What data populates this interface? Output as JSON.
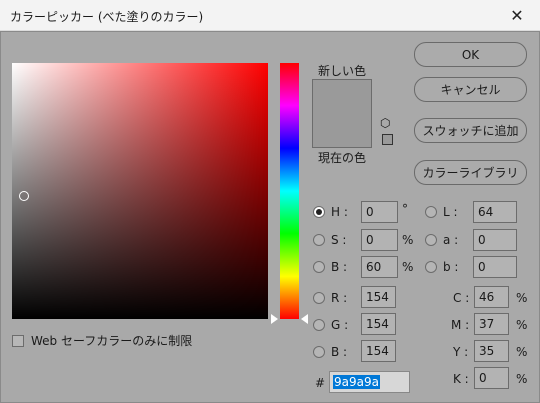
{
  "window": {
    "title": "カラーピッカー (べた塗りのカラー)"
  },
  "swatch": {
    "new_label": "新しい色",
    "current_label": "現在の色",
    "new_color": "#9a9a9a",
    "current_color": "#9a9a9a"
  },
  "buttons": {
    "ok": "OK",
    "cancel": "キャンセル",
    "add_swatch": "スウォッチに追加",
    "libraries": "カラーライブラリ"
  },
  "web_only": {
    "label": "Web セーフカラーのみに制限",
    "checked": false
  },
  "hsb": {
    "h": {
      "label": "H :",
      "value": "0",
      "unit": "°",
      "selected": true
    },
    "s": {
      "label": "S :",
      "value": "0",
      "unit": "%"
    },
    "b": {
      "label": "B :",
      "value": "60",
      "unit": "%"
    }
  },
  "lab": {
    "l": {
      "label": "L :",
      "value": "64"
    },
    "a": {
      "label": "a :",
      "value": "0"
    },
    "b": {
      "label": "b :",
      "value": "0"
    }
  },
  "rgb": {
    "r": {
      "label": "R :",
      "value": "154"
    },
    "g": {
      "label": "G :",
      "value": "154"
    },
    "b": {
      "label": "B :",
      "value": "154"
    }
  },
  "cmyk": {
    "c": {
      "label": "C :",
      "value": "46",
      "unit": "%"
    },
    "m": {
      "label": "M :",
      "value": "37",
      "unit": "%"
    },
    "y": {
      "label": "Y :",
      "value": "35",
      "unit": "%"
    },
    "k": {
      "label": "K :",
      "value": "0",
      "unit": "%"
    }
  },
  "hex": {
    "label": "#",
    "value": "9a9a9a"
  },
  "icons": {
    "close": "close-icon",
    "cube": "cube-icon"
  }
}
